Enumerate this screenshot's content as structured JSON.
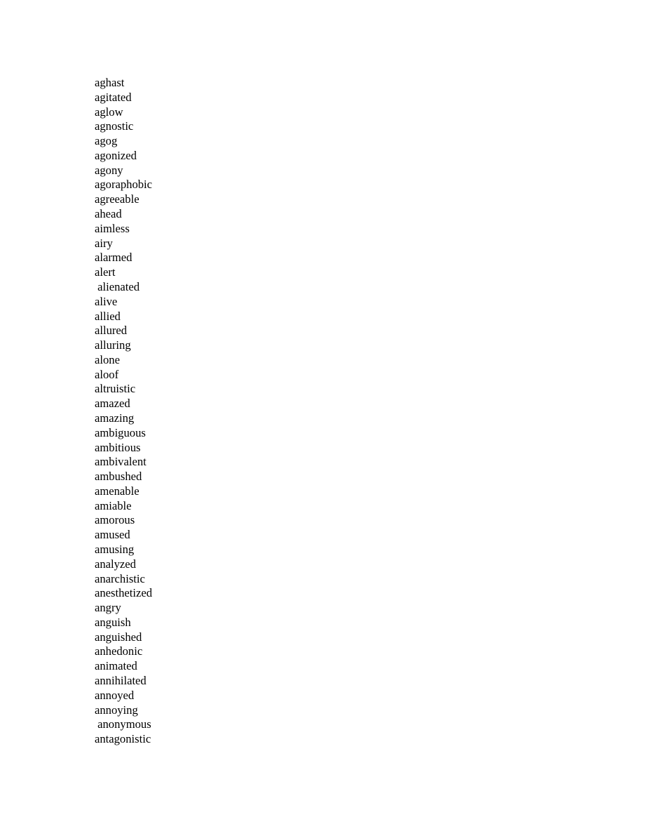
{
  "document": {
    "page_background": "#ffffff",
    "text_color": "#000000",
    "page_number_visible": false,
    "word_list": [
      "aghast",
      "agitated",
      "aglow",
      "agnostic",
      "agog",
      "agonized",
      "agony",
      "agoraphobic",
      "agreeable",
      "ahead",
      "aimless",
      "airy",
      "alarmed",
      "alert",
      " alienated",
      "alive",
      "allied",
      "allured",
      "alluring",
      "alone",
      "aloof",
      "altruistic",
      "amazed",
      "amazing",
      "ambiguous",
      "ambitious",
      "ambivalent",
      "ambushed",
      "amenable",
      "amiable",
      "amorous",
      "amused",
      "amusing",
      "analyzed",
      "anarchistic",
      "anesthetized",
      "angry",
      "anguish",
      "anguished",
      "anhedonic",
      "animated",
      "annihilated",
      "annoyed",
      "annoying",
      " anonymous",
      "antagonistic"
    ]
  }
}
